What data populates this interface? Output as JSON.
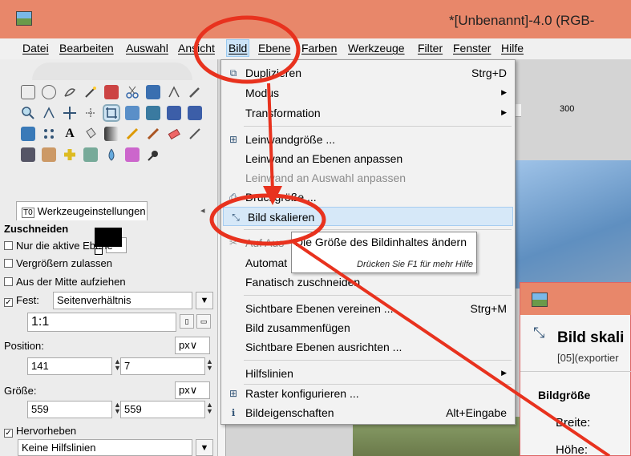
{
  "window": {
    "title": "*[Unbenannt]-4.0 (RGB-"
  },
  "menubar": {
    "items": [
      {
        "label": "Datei"
      },
      {
        "label": "Bearbeiten"
      },
      {
        "label": "Auswahl"
      },
      {
        "label": "Ansicht"
      },
      {
        "label": "Bild"
      },
      {
        "label": "Ebene"
      },
      {
        "label": "Farben"
      },
      {
        "label": "Werkzeuge"
      },
      {
        "label": "Filter"
      },
      {
        "label": "Fenster"
      },
      {
        "label": "Hilfe"
      }
    ],
    "active": "Bild"
  },
  "toolbox": {
    "tab_label": "Werkzeugeinstellungen",
    "section_title": "Zuschneiden",
    "options": {
      "only_active_layer": "Nur die aktive Ebene",
      "allow_growing": "Vergrößern zulassen",
      "expand_from_center": "Aus der Mitte aufziehen",
      "fixed_label": "Fest:",
      "fixed_value": "Seitenverhältnis",
      "ratio_value": "1:1",
      "position_label": "Position:",
      "position_unit": "px",
      "position_x": "141",
      "position_y": "7",
      "size_label": "Größe:",
      "size_unit": "px",
      "size_w": "559",
      "size_h": "559",
      "highlight_label": "Hervorheben",
      "guides_value": "Keine Hilfslinien"
    }
  },
  "ruler": {
    "tick_label": "300"
  },
  "image_menu": {
    "items": [
      {
        "label": "Duplizieren",
        "accel": "Strg+D",
        "icon": "duplicate-icon"
      },
      {
        "label": "Modus",
        "submenu": true
      },
      {
        "label": "Transformation",
        "submenu": true
      },
      {
        "label": "Leinwandgröße ...",
        "icon": "canvas-size-icon"
      },
      {
        "label": "Leinwand an Ebenen anpassen"
      },
      {
        "label": "Leinwand an Auswahl anpassen",
        "disabled": true
      },
      {
        "label": "Druckgröße ...",
        "icon": "print-size-icon"
      },
      {
        "label": "Bild skalieren",
        "icon": "scale-image-icon",
        "highlighted": true
      },
      {
        "label": "Auf Aus",
        "icon": "crop-icon",
        "disabled": true
      },
      {
        "label": "Automat"
      },
      {
        "label": "Fanatisch zuschneiden"
      },
      {
        "label": "Sichtbare Ebenen vereinen ...",
        "accel": "Strg+M"
      },
      {
        "label": "Bild zusammenfügen"
      },
      {
        "label": "Sichtbare Ebenen ausrichten ..."
      },
      {
        "label": "Hilfslinien",
        "submenu": true
      },
      {
        "label": "Raster konfigurieren ...",
        "icon": "grid-icon"
      },
      {
        "label": "Bildeigenschaften",
        "accel": "Alt+Eingabe",
        "icon": "info-icon"
      }
    ]
  },
  "tooltip": {
    "text": "Die Größe des Bildinhaltes ändern",
    "hint": "Drücken Sie F1 für mehr Hilfe"
  },
  "scale_dialog": {
    "title": "Bild skali",
    "subtitle": "[05](exportier",
    "section": "Bildgröße",
    "width_label": "Breite:",
    "height_label": "Höhe:"
  },
  "colors": {
    "annotation": "#e8321e",
    "titlebar": "#e8876a",
    "highlight": "#d6e8f8"
  }
}
